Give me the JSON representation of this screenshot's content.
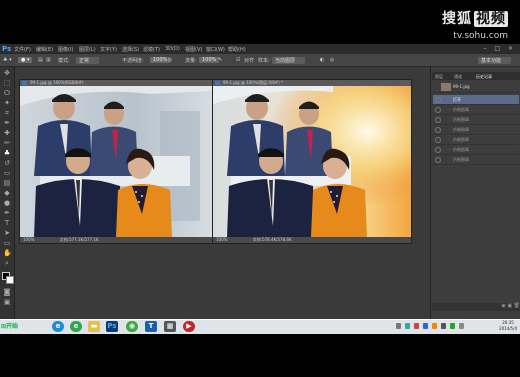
{
  "watermark": {
    "logo_text": "搜狐",
    "logo_boxed": "视频",
    "url": "tv.sohu.com"
  },
  "app": {
    "logo": "Ps",
    "menu": [
      "文件(F)",
      "编辑(E)",
      "图像(I)",
      "图层(L)",
      "文字(Y)",
      "选择(S)",
      "滤镜(T)",
      "3D(D)",
      "视图(V)",
      "窗口(W)",
      "帮助(H)"
    ],
    "window_controls": "– □ ×"
  },
  "options_bar": {
    "mode_label": "模式:",
    "mode_value": "正常",
    "opacity_label": "不透明度:",
    "opacity_value": "100%",
    "flow_label": "流量:",
    "flow_value": "100%",
    "sample_label": "对齐",
    "sample_source_label": "样本:",
    "sample_source_value": "当前图层",
    "workspace": "基本功能"
  },
  "documents": [
    {
      "tab": "99-1.jpg @ 100%(RGB/8#)",
      "zoom": "100%",
      "doc_size": "文档:577.1K/577.1K"
    },
    {
      "tab": "99-1.jpg @ 100%(图层 0/8#) *",
      "zoom": "100%",
      "doc_size": "文档:578.4K/578.6K"
    }
  ],
  "panels": {
    "tabs": [
      "图层",
      "通道",
      "历史记录"
    ],
    "layers": [
      {
        "name": "99-1.jpg"
      },
      {
        "name": "打开"
      },
      {
        "name": "仿制图章"
      },
      {
        "name": "仿制图章"
      },
      {
        "name": "仿制图章"
      },
      {
        "name": "仿制图章"
      },
      {
        "name": "仿制图章"
      },
      {
        "name": "仿制图章"
      }
    ],
    "bottom_icons": "◉ ▣ 🗑"
  },
  "taskbar": {
    "start_label": "开始",
    "clock_time": "20:35",
    "clock_date": "2014/5/4"
  },
  "colors": {
    "ps_blue": "#4ea6ff",
    "panel_bg": "#3d3d3d",
    "ui_bg": "#3a3a3a",
    "selected_layer": "#5a6b8c"
  }
}
